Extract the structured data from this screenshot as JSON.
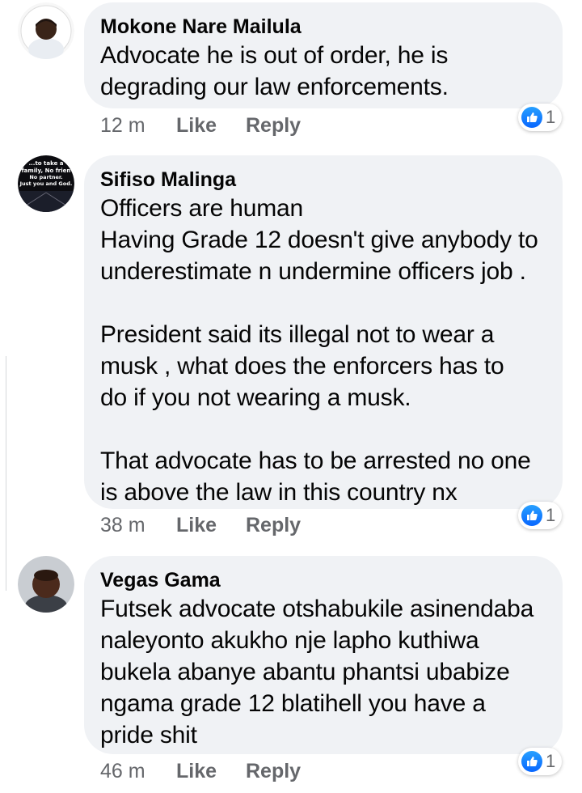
{
  "comments": [
    {
      "author": "Mokone Nare Mailula",
      "text": "Advocate he is out of order, he is\ndegrading our law enforcements.",
      "time": "12 m",
      "like_label": "Like",
      "reply_label": "Reply",
      "reaction_count": "1"
    },
    {
      "author": "Sifiso Malinga",
      "text": "Officers are human\nHaving Grade 12 doesn't give anybody to\nunderestimate n undermine officers job .\n\nPresident said its illegal not to wear a\nmusk , what does the enforcers has to\ndo if you not wearing a musk.\n\nThat advocate has to be arrested no one\nis above the law in this country nx",
      "time": "38 m",
      "like_label": "Like",
      "reply_label": "Reply",
      "reaction_count": "1",
      "avatar_caption": "...to take a... family, No frien... No partner. Just you and God."
    },
    {
      "author": "Vegas Gama",
      "text": "Futsek advocate otshabukile asinendaba\nnaleyonto akukho nje lapho kuthiwa\nbukela abanye abantu phantsi ubabize\nngama grade 12 blatihell you have a\npride shit",
      "time": "46 m",
      "like_label": "Like",
      "reply_label": "Reply",
      "reaction_count": "1"
    }
  ],
  "colors": {
    "bubble": "#f0f2f5",
    "secondary_text": "#65676b",
    "like_blue": "#0866ff"
  }
}
